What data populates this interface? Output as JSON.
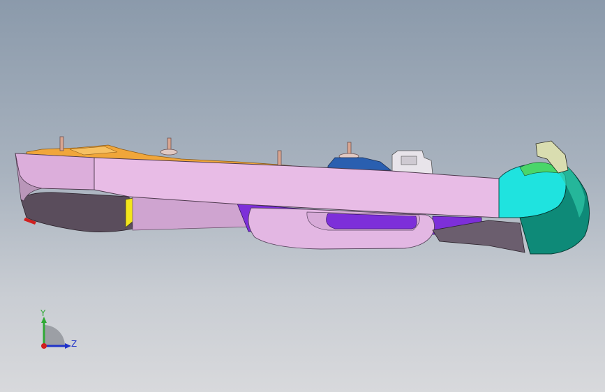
{
  "viewport": {
    "background_top": "#8b9aab",
    "background_bottom": "#d8d9dc"
  },
  "model": {
    "colors": {
      "body": "#e8bce6",
      "body_shadow": "#b996b9",
      "orange_parts": "#f0a63a",
      "cyan_part": "#1fe3df",
      "teal_part": "#0e8a78",
      "violet_parts": "#7d2fd9",
      "yellow_part": "#f3e61c",
      "dark_underside": "#5a4d5c",
      "blue_part": "#2a5fb0"
    }
  },
  "triad": {
    "y_label": "Y",
    "z_label": "Z",
    "y_color": "#2faa35",
    "z_color": "#2033c9",
    "x_color": "#d01f1f"
  }
}
